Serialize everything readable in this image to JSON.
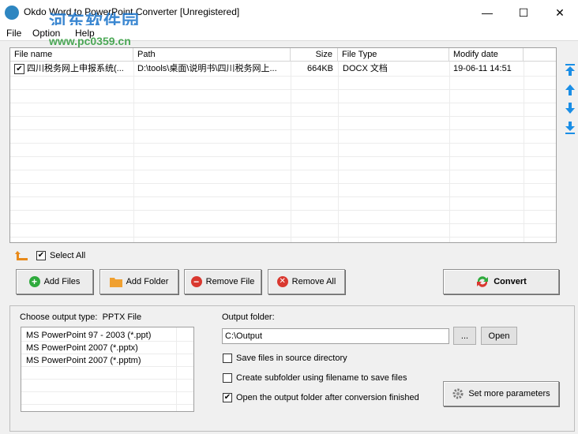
{
  "window": {
    "title": "Okdo Word to PowerPoint Converter [Unregistered]",
    "minimize": "—",
    "maximize": "☐",
    "close": "✕"
  },
  "watermark": {
    "text": "河东软件园",
    "url": "www.pc0359.cn"
  },
  "menu": [
    "File",
    "Option",
    "Help"
  ],
  "filelist": {
    "columns": [
      "File name",
      "Path",
      "Size",
      "File Type",
      "Modify date"
    ],
    "rows": [
      {
        "checked": true,
        "name": "四川税务网上申报系统(...",
        "path": "D:\\tools\\桌面\\说明书\\四川税务网上...",
        "size": "664KB",
        "type": "DOCX 文档",
        "date": "19-06-11 14:51"
      }
    ]
  },
  "select_all": {
    "label": "Select All",
    "checked": true
  },
  "buttons": {
    "add_files": "Add Files",
    "add_folder": "Add Folder",
    "remove_file": "Remove File",
    "remove_all": "Remove All",
    "convert": "Convert"
  },
  "output": {
    "type_label": "Choose output type:",
    "type_value": "PPTX File",
    "types": [
      "MS PowerPoint 97 - 2003 (*.ppt)",
      "MS PowerPoint 2007 (*.pptx)",
      "MS PowerPoint 2007 (*.pptm)"
    ],
    "folder_label": "Output folder:",
    "folder_value": "C:\\Output",
    "browse": "...",
    "open": "Open",
    "options": [
      {
        "label": "Save files in source directory",
        "checked": false
      },
      {
        "label": "Create subfolder using filename to save files",
        "checked": false
      },
      {
        "label": "Open the output folder after conversion finished",
        "checked": true
      }
    ],
    "more_params": "Set more parameters"
  },
  "colors": {
    "accent_blue": "#1a8ee6",
    "add_green": "#2eaa3c",
    "remove_red": "#d9382f",
    "folder_orange": "#f0a030",
    "up_arrow_orange": "#e88a1a"
  }
}
